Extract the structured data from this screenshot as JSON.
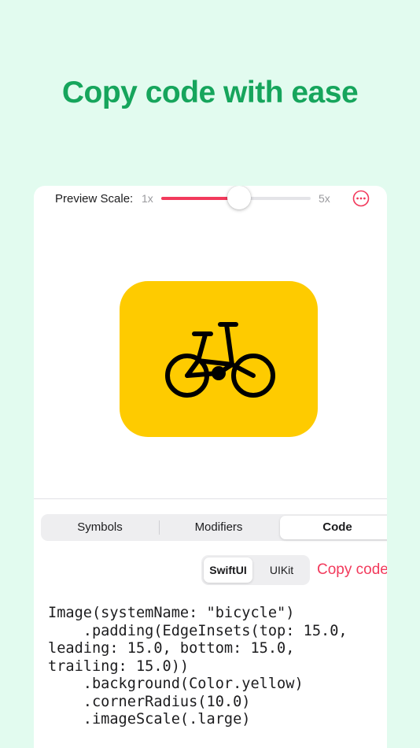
{
  "headline": "Copy code with ease",
  "preview": {
    "scale_label": "Preview Scale:",
    "scale_min": "1x",
    "scale_max": "5x",
    "scale_fraction": 0.52,
    "symbol_name": "bicycle",
    "background_color": "#fecb00",
    "more_icon": "ellipsis-circle-icon"
  },
  "tabs": {
    "items": [
      "Symbols",
      "Modifiers",
      "Code"
    ],
    "selected": "Code"
  },
  "code_view": {
    "frameworks": [
      "SwiftUI",
      "UIKit"
    ],
    "selected_framework": "SwiftUI",
    "copy_label": "Copy code",
    "code_lines": [
      "Image(systemName: \"bicycle\")",
      "    .padding(EdgeInsets(top: 15.0,",
      "leading: 15.0, bottom: 15.0,",
      "trailing: 15.0))",
      "    .background(Color.yellow)",
      "    .cornerRadius(10.0)",
      "    .imageScale(.large)"
    ]
  },
  "colors": {
    "accent": "#f23a5c",
    "headline": "#16a55c",
    "page_background": "#e2fbef"
  }
}
